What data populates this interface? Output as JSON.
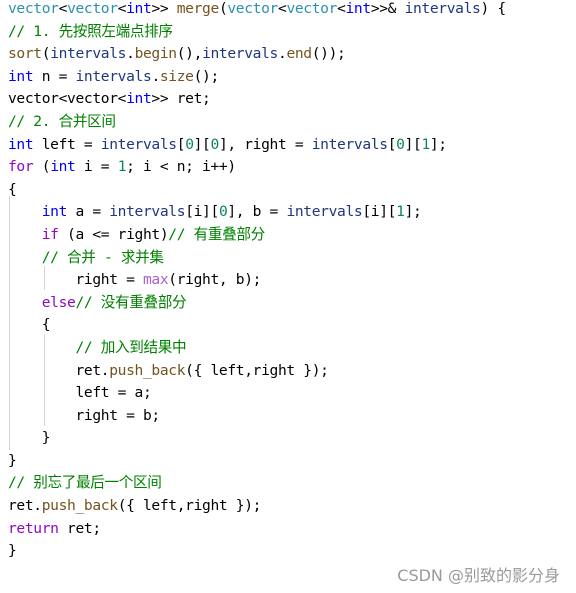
{
  "code_lines": [
    [
      {
        "t": "vector",
        "c": "type"
      },
      {
        "t": "<",
        "c": "var"
      },
      {
        "t": "vector",
        "c": "type"
      },
      {
        "t": "<",
        "c": "var"
      },
      {
        "t": "int",
        "c": "kw"
      },
      {
        "t": ">> ",
        "c": "var"
      },
      {
        "t": "merge",
        "c": "fn"
      },
      {
        "t": "(",
        "c": "var"
      },
      {
        "t": "vector",
        "c": "type"
      },
      {
        "t": "<",
        "c": "var"
      },
      {
        "t": "vector",
        "c": "type"
      },
      {
        "t": "<",
        "c": "var"
      },
      {
        "t": "int",
        "c": "kw"
      },
      {
        "t": ">>& ",
        "c": "var"
      },
      {
        "t": "intervals",
        "c": "param"
      },
      {
        "t": ") {",
        "c": "var"
      }
    ],
    [
      {
        "t": "// 1. 先按照左端点排序",
        "c": "cm"
      }
    ],
    [
      {
        "t": "sort",
        "c": "fn"
      },
      {
        "t": "(",
        "c": "var"
      },
      {
        "t": "intervals",
        "c": "param"
      },
      {
        "t": ".",
        "c": "var"
      },
      {
        "t": "begin",
        "c": "fn"
      },
      {
        "t": "(),",
        "c": "var"
      },
      {
        "t": "intervals",
        "c": "param"
      },
      {
        "t": ".",
        "c": "var"
      },
      {
        "t": "end",
        "c": "fn"
      },
      {
        "t": "());",
        "c": "var"
      }
    ],
    [
      {
        "t": "int",
        "c": "kw"
      },
      {
        "t": " n = ",
        "c": "var"
      },
      {
        "t": "intervals",
        "c": "param"
      },
      {
        "t": ".",
        "c": "var"
      },
      {
        "t": "size",
        "c": "fn"
      },
      {
        "t": "();",
        "c": "var"
      }
    ],
    [
      {
        "t": "vector<vector<",
        "c": "var"
      },
      {
        "t": "int",
        "c": "kw"
      },
      {
        "t": ">> ret;",
        "c": "var"
      }
    ],
    [
      {
        "t": "// 2. 合并区间",
        "c": "cm"
      }
    ],
    [
      {
        "t": "int",
        "c": "kw"
      },
      {
        "t": " left = ",
        "c": "var"
      },
      {
        "t": "intervals",
        "c": "param"
      },
      {
        "t": "[",
        "c": "var"
      },
      {
        "t": "0",
        "c": "num"
      },
      {
        "t": "][",
        "c": "var"
      },
      {
        "t": "0",
        "c": "num"
      },
      {
        "t": "], right = ",
        "c": "var"
      },
      {
        "t": "intervals",
        "c": "param"
      },
      {
        "t": "[",
        "c": "var"
      },
      {
        "t": "0",
        "c": "num"
      },
      {
        "t": "][",
        "c": "var"
      },
      {
        "t": "1",
        "c": "num"
      },
      {
        "t": "];",
        "c": "var"
      }
    ],
    [
      {
        "t": "for",
        "c": "ctl"
      },
      {
        "t": " (",
        "c": "var"
      },
      {
        "t": "int",
        "c": "kw"
      },
      {
        "t": " i = ",
        "c": "var"
      },
      {
        "t": "1",
        "c": "num"
      },
      {
        "t": "; i < n; i++)",
        "c": "var"
      }
    ],
    [
      {
        "t": "{",
        "c": "var"
      }
    ],
    [
      {
        "t": "    ",
        "c": "var"
      },
      {
        "t": "int",
        "c": "kw"
      },
      {
        "t": " a = ",
        "c": "var"
      },
      {
        "t": "intervals",
        "c": "param"
      },
      {
        "t": "[i][",
        "c": "var"
      },
      {
        "t": "0",
        "c": "num"
      },
      {
        "t": "], b = ",
        "c": "var"
      },
      {
        "t": "intervals",
        "c": "param"
      },
      {
        "t": "[i][",
        "c": "var"
      },
      {
        "t": "1",
        "c": "num"
      },
      {
        "t": "];",
        "c": "var"
      }
    ],
    [
      {
        "t": "    ",
        "c": "var"
      },
      {
        "t": "if",
        "c": "ctl"
      },
      {
        "t": " (a <= right)",
        "c": "var"
      },
      {
        "t": "// 有重叠部分",
        "c": "cm"
      }
    ],
    [
      {
        "t": "    ",
        "c": "var"
      },
      {
        "t": "// 合并 - 求并集",
        "c": "cm"
      }
    ],
    [
      {
        "t": "        right = ",
        "c": "var"
      },
      {
        "t": "max",
        "c": "macro"
      },
      {
        "t": "(right, b);",
        "c": "var"
      }
    ],
    [
      {
        "t": "    ",
        "c": "var"
      },
      {
        "t": "else",
        "c": "ctl"
      },
      {
        "t": "// 没有重叠部分",
        "c": "cm"
      }
    ],
    [
      {
        "t": "    {",
        "c": "var"
      }
    ],
    [
      {
        "t": "        ",
        "c": "var"
      },
      {
        "t": "// 加入到结果中",
        "c": "cm"
      }
    ],
    [
      {
        "t": "        ret.",
        "c": "var"
      },
      {
        "t": "push_back",
        "c": "fn"
      },
      {
        "t": "({ left,right });",
        "c": "var"
      }
    ],
    [
      {
        "t": "        left = a;",
        "c": "var"
      }
    ],
    [
      {
        "t": "        right = b;",
        "c": "var"
      }
    ],
    [
      {
        "t": "    }",
        "c": "var"
      }
    ],
    [
      {
        "t": "}",
        "c": "var"
      }
    ],
    [
      {
        "t": "// 别忘了最后一个区间",
        "c": "cm"
      }
    ],
    [
      {
        "t": "ret.",
        "c": "var"
      },
      {
        "t": "push_back",
        "c": "fn"
      },
      {
        "t": "({ left,right });",
        "c": "var"
      }
    ],
    [
      {
        "t": "return",
        "c": "ctl"
      },
      {
        "t": " ret;",
        "c": "var"
      }
    ],
    [
      {
        "t": "}",
        "c": "var"
      }
    ]
  ],
  "watermark": "CSDN @别致的影分身"
}
